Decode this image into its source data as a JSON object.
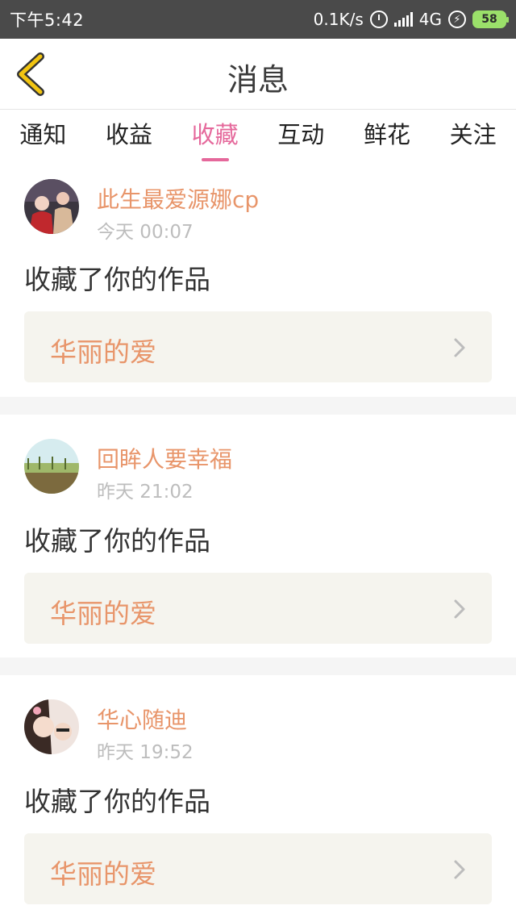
{
  "status_bar": {
    "time": "下午5:42",
    "network_speed": "0.1K/s",
    "network_type": "4G",
    "battery": "58",
    "icons": [
      "alarm-icon",
      "signal-icon",
      "charging-icon",
      "battery-icon"
    ]
  },
  "header": {
    "title": "消息",
    "back_icon": "chevron-left-icon"
  },
  "tabs": [
    {
      "label": "通知",
      "active": false
    },
    {
      "label": "收益",
      "active": false
    },
    {
      "label": "收藏",
      "active": true
    },
    {
      "label": "互动",
      "active": false
    },
    {
      "label": "鲜花",
      "active": false
    },
    {
      "label": "关注",
      "active": false
    }
  ],
  "messages": [
    {
      "user": "此生最爱源娜cp",
      "time": "今天 00:07",
      "action": "收藏了你的作品",
      "work_title": "华丽的爱"
    },
    {
      "user": "回眸人要幸福",
      "time": "昨天 21:02",
      "action": "收藏了你的作品",
      "work_title": "华丽的爱"
    },
    {
      "user": "华心随迪",
      "time": "昨天 19:52",
      "action": "收藏了你的作品",
      "work_title": "华丽的爱"
    }
  ],
  "colors": {
    "accent": "#e5689b",
    "username": "#e8956a",
    "back_chevron": "#f2c511",
    "card_bg": "#f5f4ee"
  }
}
